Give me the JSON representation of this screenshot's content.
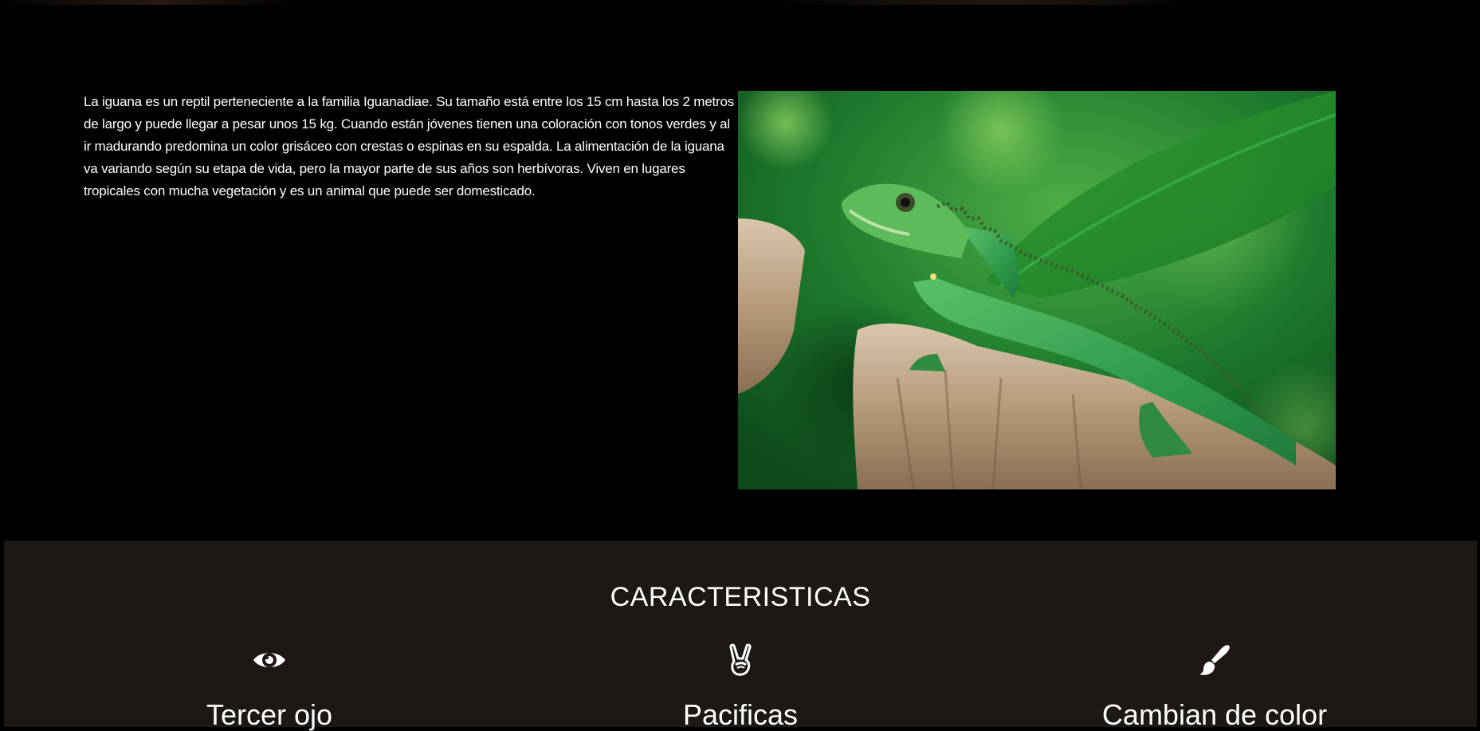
{
  "intro": {
    "paragraph": "La iguana es un reptil perteneciente a la familia Iguanadiae. Su tamaño está entre los 15 cm hasta los 2 metros de largo y puede llegar a pesar unos 15 kg. Cuando están jóvenes tienen una coloración con tonos verdes y al ir madurando predomina un color grisáceo con crestas o espinas en su espalda. La alimentación de la iguana va variando según su etapa de vida, pero la mayor parte de sus años son herbívoras. Viven en lugares tropicales con mucha vegetación y es un animal que puede ser domesticado."
  },
  "features": {
    "title": "CARACTERISTICAS",
    "items": [
      {
        "icon": "eye-icon",
        "label": "Tercer ojo"
      },
      {
        "icon": "peace-hand-icon",
        "label": "Pacificas"
      },
      {
        "icon": "paintbrush-icon",
        "label": "Cambian de color"
      }
    ]
  },
  "colors": {
    "page_background": "#000000",
    "features_background": "#1d1813",
    "text": "#ffffff"
  }
}
